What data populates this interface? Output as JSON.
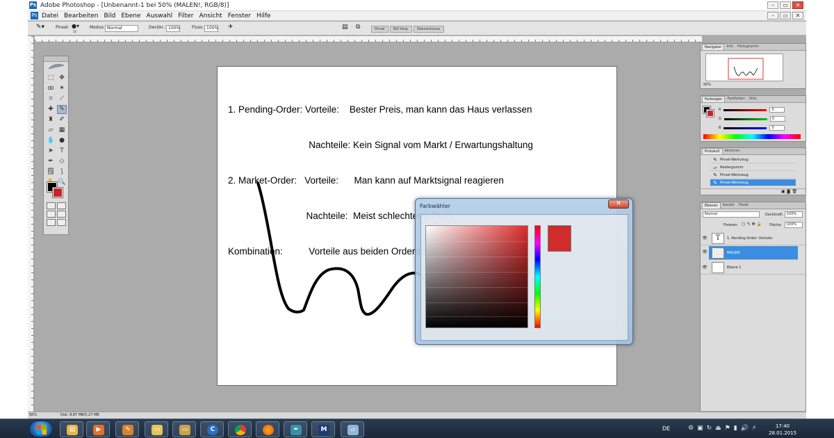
{
  "window": {
    "title": "Adobe Photoshop - [Unbenannt-1 bei 50% (MALEN!, RGB/8)]",
    "icon": "ps-icon",
    "controls": [
      "–",
      "▭",
      "✕"
    ]
  },
  "menu": [
    "Datei",
    "Bearbeiten",
    "Bild",
    "Ebene",
    "Auswahl",
    "Filter",
    "Ansicht",
    "Fenster",
    "Hilfe"
  ],
  "options": {
    "brush_label": "Pinsel:",
    "brush_size": "15",
    "mode_label": "Modus:",
    "mode_value": "Normal",
    "opacity_label": "Deckkr.:",
    "opacity_value": "100%",
    "flow_label": "Fluss:",
    "flow_value": "100%",
    "panel_tabs": [
      "Pinsel",
      "WZ-Vorg.",
      "Ebenenkomp."
    ]
  },
  "document": {
    "lines": [
      "1. Pending-Order: Vorteile:    Bester Preis, man kann das Haus verlassen",
      "                               Nachteile: Kein Signal vom Markt / Erwartungshaltung",
      "2. Market-Order:   Vorteile:      Man kann auf Marktsignal reagieren",
      "                              Nachteile:  Meist schlechterer Preis",
      "Kombination:          Vorteile aus beiden Orderarten kombinieren"
    ]
  },
  "status": {
    "zoom": "50%",
    "doc": "Dok: 8,87 MB/5,27 MB"
  },
  "navigator": {
    "tabs": [
      "Navigator",
      "Info",
      "Histogramm"
    ],
    "zoom": "50%"
  },
  "color": {
    "tabs": [
      "Farbregler",
      "Farbfelder",
      "Stile"
    ],
    "channels": [
      {
        "label": "R",
        "value": "0"
      },
      {
        "label": "G",
        "value": "0"
      },
      {
        "label": "B",
        "value": "0"
      }
    ]
  },
  "history": {
    "tabs": [
      "Protokoll",
      "Aktionen"
    ],
    "items": [
      "Pinsel-Werkzeug",
      "Radiergummi",
      "Pinsel-Werkzeug",
      "Pinsel-Werkzeug"
    ],
    "active_index": 3
  },
  "layers": {
    "tabs": [
      "Ebenen",
      "Kanäle",
      "Pfade"
    ],
    "blend_mode": "Normal",
    "opacity_label": "Deckkraft:",
    "opacity_value": "100%",
    "lock_label": "Fixieren:",
    "fill_label": "Fläche:",
    "fill_value": "100%",
    "items": [
      {
        "name": "1. Pending-Order: Vorteile:",
        "thumb": "T"
      },
      {
        "name": "MALEN!",
        "thumb": ""
      },
      {
        "name": "Ebene 1",
        "thumb": ""
      }
    ],
    "active_index": 1
  },
  "dialog": {
    "title": "Farbwähler",
    "close": "✕",
    "swatch_color": "#d02c2c"
  },
  "colors": {
    "foreground": "#000000",
    "background": "#c6242a",
    "selection": "#3a8de0"
  },
  "taskbar": {
    "language": "DE",
    "time": "17:40",
    "date": "28.01.2015",
    "apps": [
      "file-explorer-icon",
      "media-player-icon",
      "paint-icon",
      "folder-icon",
      "network-folder-icon",
      "ccleaner-icon",
      "chrome-icon",
      "firefox-icon",
      "feather-icon",
      "mt-icon",
      "window-icon"
    ]
  }
}
